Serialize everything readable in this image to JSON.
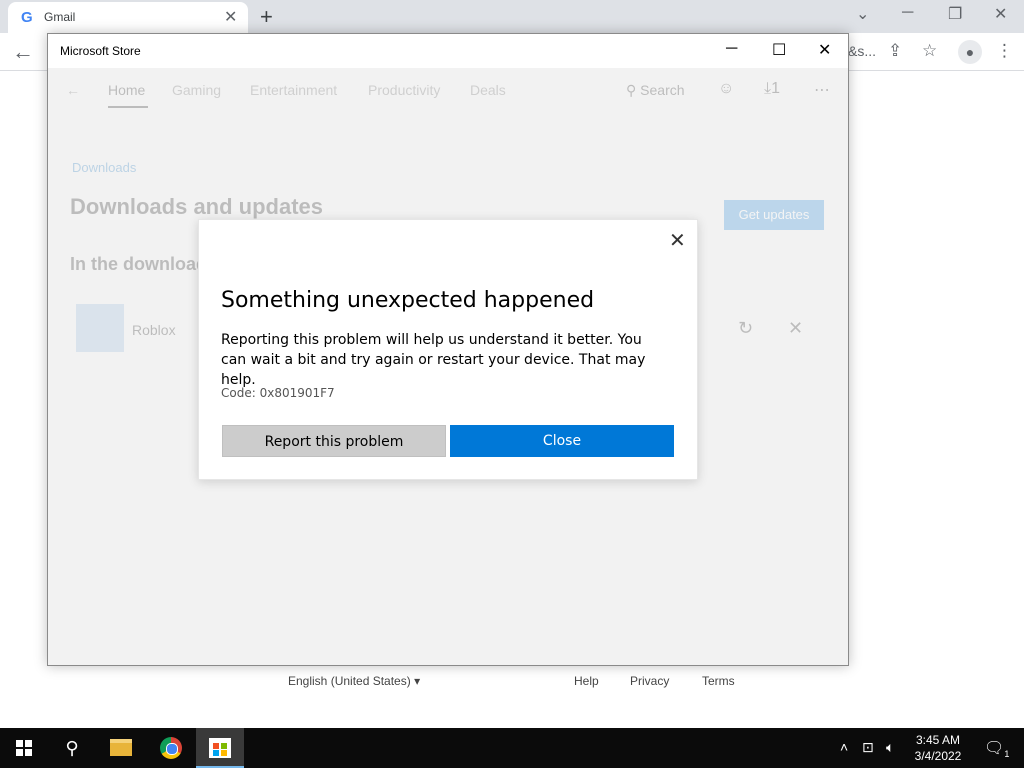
{
  "browser": {
    "tab_title": "Gmail",
    "omnibox_tail": "&s...",
    "footer": {
      "language": "English (United States)",
      "help": "Help",
      "privacy": "Privacy",
      "terms": "Terms"
    }
  },
  "store": {
    "window_title": "Microsoft Store",
    "nav": {
      "home": "Home",
      "gaming": "Gaming",
      "entertainment": "Entertainment",
      "productivity": "Productivity",
      "deals": "Deals",
      "search": "Search",
      "downloads_count": "1"
    },
    "breadcrumb": "Downloads",
    "page_title": "Downloads and updates",
    "get_updates": "Get updates",
    "section_title": "In the download queue",
    "app_name": "Roblox"
  },
  "dialog": {
    "title": "Something unexpected happened",
    "message": "Reporting this problem will help us understand it better. You can wait a bit and try again or restart your device. That may help.",
    "code": "Code: 0x801901F7",
    "report_button": "Report this problem",
    "close_button": "Close"
  },
  "taskbar": {
    "time": "3:45 AM",
    "date": "3/4/2022",
    "notification_count": "1"
  },
  "colors": {
    "accent": "#0078d7",
    "dialog_bg": "#ffffff",
    "secondary_button": "#cccccc",
    "taskbar_bg": "#0b0b0b"
  }
}
